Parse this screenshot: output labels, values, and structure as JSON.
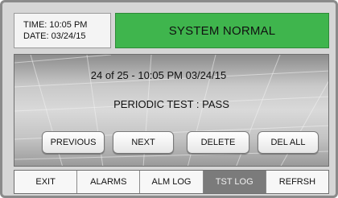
{
  "header": {
    "time_label": "TIME: 10:05 PM",
    "date_label": "DATE: 03/24/15",
    "status": "SYSTEM NORMAL",
    "status_color": "#3fb54d"
  },
  "log": {
    "entry_line": "24 of 25 - 10:05 PM 03/24/15",
    "message": "PERIODIC TEST : PASS"
  },
  "controls": {
    "previous": "PREVIOUS",
    "next": "NEXT",
    "delete": "DELETE",
    "delete_all": "DEL ALL"
  },
  "tabs": [
    {
      "label": "EXIT",
      "active": false
    },
    {
      "label": "ALARMS",
      "active": false
    },
    {
      "label": "ALM LOG",
      "active": false
    },
    {
      "label": "TST LOG",
      "active": true
    },
    {
      "label": "REFRSH",
      "active": false
    }
  ]
}
